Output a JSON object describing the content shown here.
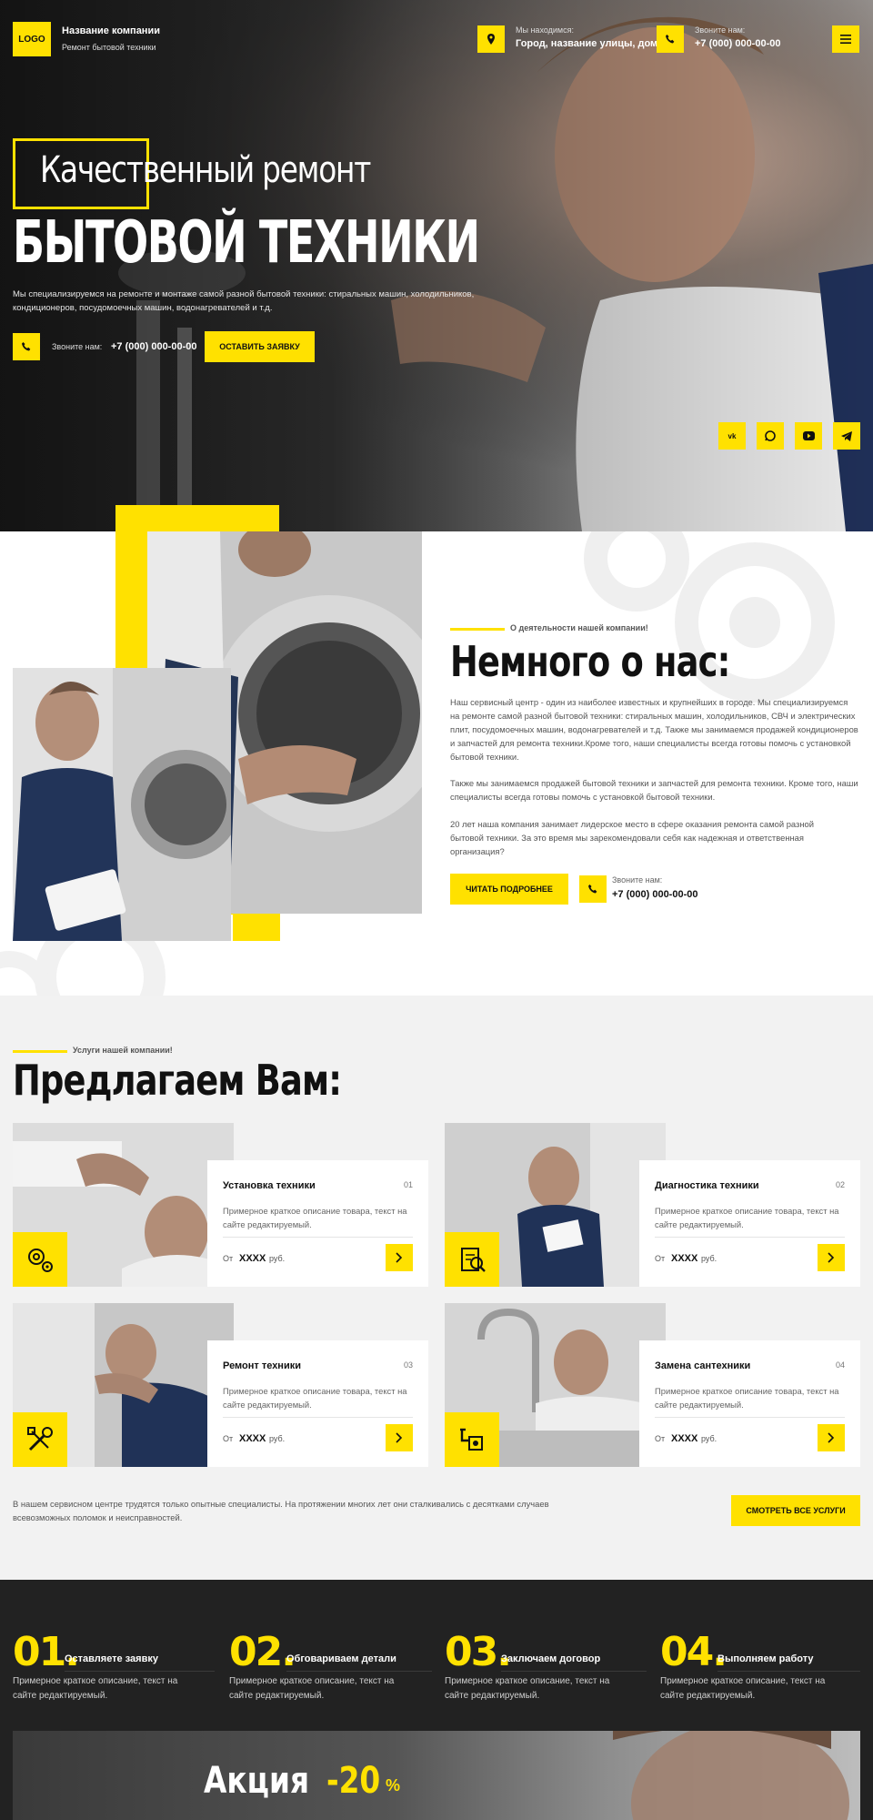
{
  "header": {
    "logo": "LOGO",
    "company_name": "Название компании",
    "company_sub": "Ремонт бытовой техники",
    "address_label": "Мы находимся:",
    "address_value": "Город, название улицы, дом",
    "phone_label": "Звоните нам:",
    "phone_value": "+7 (000) 000-00-00"
  },
  "hero": {
    "title_line1": "Качественный ремонт",
    "title_line2": "БЫТОВОЙ ТЕХНИКИ",
    "description": "Мы специализируемся на ремонте и монтаже самой разной бытовой техники: стиральных машин, холодильников, кондиционеров, посудомоечных машин, водонагревателей и т.д.",
    "call_label": "Звоните нам:",
    "call_phone": "+7 (000) 000-00-00",
    "cta": "ОСТАВИТЬ ЗАЯВКУ",
    "socials": [
      "vk-icon",
      "whatsapp-icon",
      "youtube-icon",
      "telegram-icon"
    ]
  },
  "about": {
    "kicker": "О деятельности нашей компании!",
    "title": "Немного о нас:",
    "p1": "Наш сервисный центр - один из наиболее известных и крупнейших в городе. Мы специализируемся на ремонте самой разной бытовой техники: стиральных машин, холодильников, СВЧ и электрических плит, посудомоечных машин, водонагревателей и т.д. Также мы занимаемся продажей кондиционеров и запчастей для ремонта техники.Кроме того, наши специалисты всегда готовы помочь с установкой бытовой техники.",
    "p2": "Также мы занимаемся продажей бытовой техники и запчастей для ремонта техники. Кроме того, наши специалисты всегда готовы помочь с установкой бытовой техники.",
    "p3": "20 лет наша компания занимает лидерское место в сфере оказания ремонта самой разной бытовой техники. За это время мы зарекомендовали себя как надежная и ответственная организация?",
    "read_more": "ЧИТАТЬ ПОДРОБНЕЕ",
    "call_label": "Звоните нам:",
    "call_phone": "+7 (000) 000-00-00"
  },
  "services": {
    "kicker": "Услуги нашей компании!",
    "title": "Предлагаем Вам:",
    "items": [
      {
        "title": "Установка техники",
        "num": "01",
        "desc": "Примерное краткое описание товара, текст на сайте редактируемый.",
        "price_from": "От",
        "price": "XXXX",
        "currency": "руб.",
        "icon": "gears-icon"
      },
      {
        "title": "Диагностика техники",
        "num": "02",
        "desc": "Примерное краткое описание товара, текст на сайте редактируемый.",
        "price_from": "От",
        "price": "XXXX",
        "currency": "руб.",
        "icon": "clipboard-search-icon"
      },
      {
        "title": "Ремонт техники",
        "num": "03",
        "desc": "Примерное краткое описание товара, текст на сайте редактируемый.",
        "price_from": "От",
        "price": "XXXX",
        "currency": "руб.",
        "icon": "tools-icon"
      },
      {
        "title": "Замена сантехники",
        "num": "04",
        "desc": "Примерное краткое описание товара, текст на сайте редактируемый.",
        "price_from": "От",
        "price": "XXXX",
        "currency": "руб.",
        "icon": "plumbing-icon"
      }
    ],
    "note": "В нашем сервисном центре трудятся только опытные специалисты. На протяжении многих лет они сталкивались с десятками случаев всевозможных поломок и неисправностей.",
    "all_button": "СМОТРЕТЬ ВСЕ УСЛУГИ"
  },
  "steps": [
    {
      "num": "01.",
      "title": "Оставляете заявку",
      "desc": "Примерное краткое описание, текст на сайте редактируемый."
    },
    {
      "num": "02.",
      "title": "Обговариваем детали",
      "desc": "Примерное краткое описание, текст на сайте редактируемый."
    },
    {
      "num": "03.",
      "title": "Заключаем договор",
      "desc": "Примерное краткое описание, текст на сайте редактируемый."
    },
    {
      "num": "04.",
      "title": "Выполняем работу",
      "desc": "Примерное краткое описание, текст на сайте редактируемый."
    }
  ],
  "promo": {
    "label": "Акция",
    "discount": "-20",
    "percent": "%"
  },
  "colors": {
    "accent": "#ffe100",
    "dark": "#222222",
    "light_bg": "#f2f2f2"
  }
}
